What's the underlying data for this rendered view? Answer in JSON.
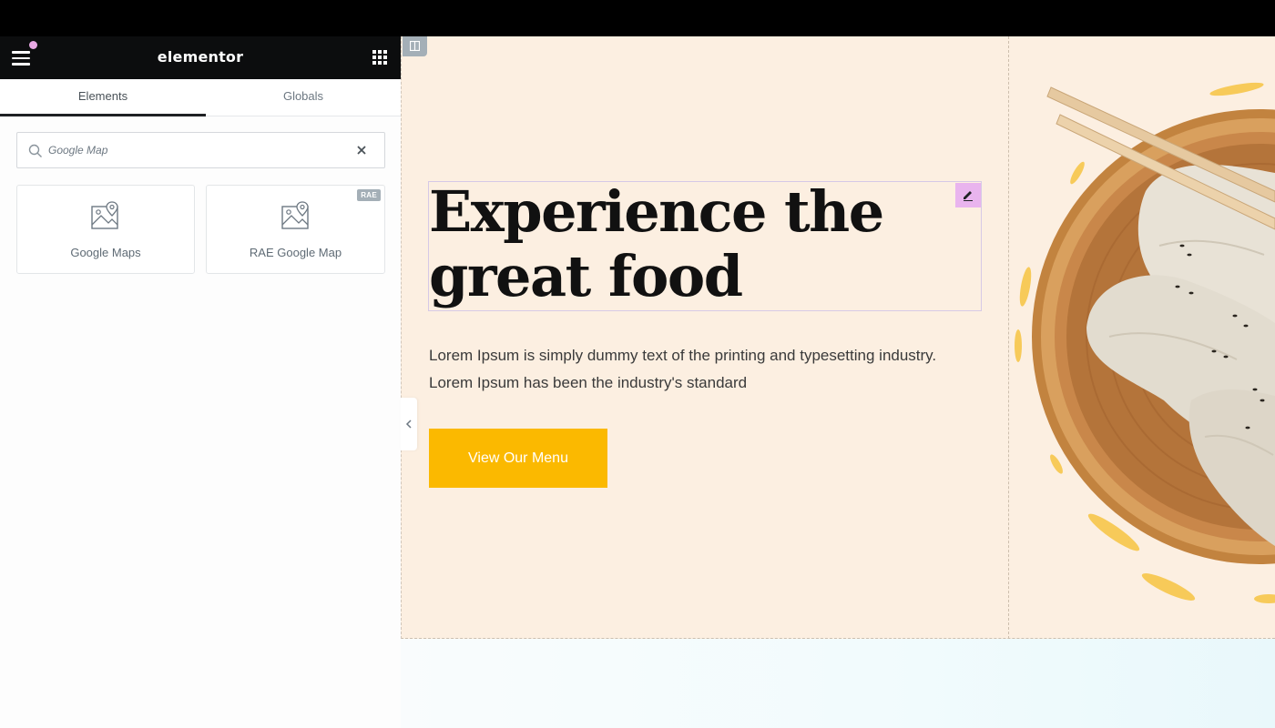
{
  "panel": {
    "brand": "elementor",
    "tabs": [
      {
        "label": "Elements",
        "active": true
      },
      {
        "label": "Globals",
        "active": false
      }
    ],
    "search": {
      "value": "Google Map",
      "icon": "search-icon",
      "clear_icon": "close-icon"
    },
    "widgets": [
      {
        "label": "Google Maps",
        "icon": "google-maps-icon"
      },
      {
        "label": "RAE Google Map",
        "icon": "google-maps-icon",
        "badge": "RAE"
      }
    ]
  },
  "canvas": {
    "heading": "Experience the great food",
    "body": "Lorem Ipsum is simply dummy text of the printing and typesetting industry. Lorem Ipsum has been the industry's standard",
    "cta_label": "View Our Menu"
  },
  "colors": {
    "header_bg": "#0c0d0e",
    "section_bg": "#fcefe1",
    "cta": "#fbb900",
    "edit_handle": "#e9b4ee",
    "notification_dot": "#e8a8e4"
  }
}
